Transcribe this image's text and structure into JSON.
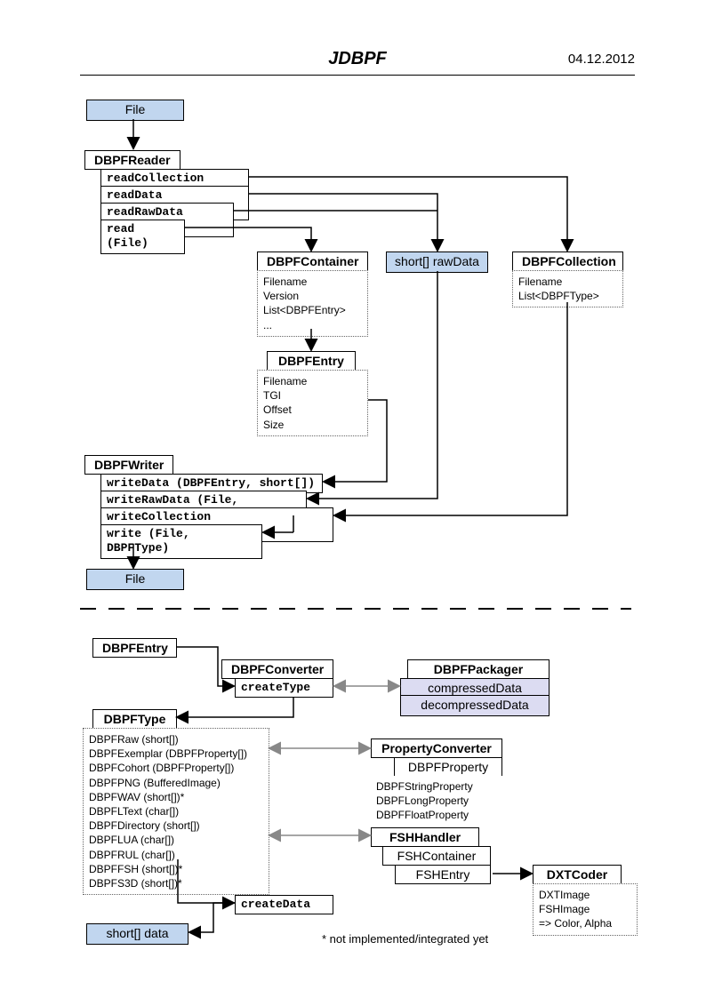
{
  "header": {
    "title": "JDBPF",
    "date": "04.12.2012"
  },
  "file_top": "File",
  "file_bottom": "File",
  "reader": {
    "name": "DBPFReader",
    "m0": "readCollection (File)",
    "m1": "readData (DBPFEntry)",
    "m2": "readRawData (File)",
    "m3": "read (File)"
  },
  "rawdata": "short[] rawData",
  "container": {
    "name": "DBPFContainer",
    "body": "Filename\nVersion\nList<DBPFEntry>\n..."
  },
  "entry": {
    "name": "DBPFEntry",
    "body": "Filename\nTGI\nOffset\nSize"
  },
  "collection": {
    "name": "DBPFCollection",
    "body": "Filename\nList<DBPFType>"
  },
  "writer": {
    "name": "DBPFWriter",
    "m0": "writeData (DBPFEntry, short[])",
    "m1": "writeRawData (File, short[])",
    "m2": "writeCollection (DBPFCollection)",
    "m3": "write (File, DBPFType)"
  },
  "entry2": "DBPFEntry",
  "converter": {
    "name": "DBPFConverter",
    "m": "createType"
  },
  "packager": {
    "name": "DBPFPackager",
    "m0": "compressedData",
    "m1": "decompressedData"
  },
  "type": {
    "name": "DBPFType",
    "body": "DBPFRaw (short[])\nDBPFExemplar (DBPFProperty[])\nDBPFCohort (DBPFProperty[])\nDBPFPNG (BufferedImage)\nDBPFWAV (short[])*\nDBPFLText (char[])\nDBPFDirectory (short[])\nDBPFLUA (char[])\nDBPFRUL (char[])\nDBPFFSH (short[])*\nDBPFS3D (short[])*"
  },
  "propconv": {
    "name": "PropertyConverter",
    "sub": "DBPFProperty",
    "body": "DBPFStringProperty\nDBPFLongProperty\nDBPFFloatProperty"
  },
  "fsh": {
    "name": "FSHHandler",
    "s0": "FSHContainer",
    "s1": "FSHEntry"
  },
  "dxt": {
    "name": "DXTCoder",
    "body": "DXTImage\nFSHImage\n=> Color, Alpha"
  },
  "createData": "createData",
  "shortdata": "short[] data",
  "footnote": "* not implemented/integrated yet"
}
